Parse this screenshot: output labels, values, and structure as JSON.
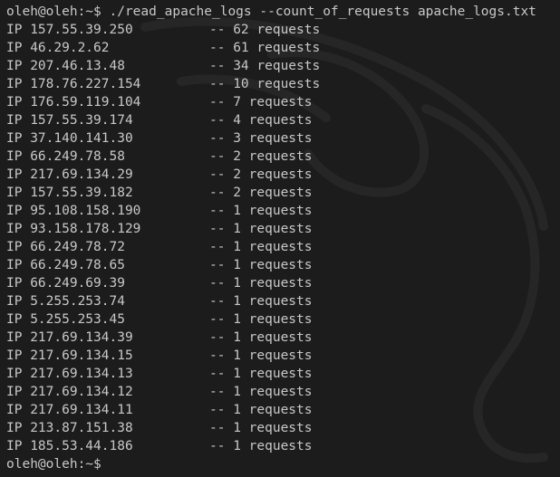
{
  "terminal": {
    "prompt": "oleh@oleh:~$",
    "command": " ./read_apache_logs --count_of_requests apache_logs.txt",
    "final_prompt": "oleh@oleh:~$"
  },
  "rows": [
    {
      "ip": "IP 157.55.39.250",
      "count": "-- 62 requests"
    },
    {
      "ip": "IP 46.29.2.62",
      "count": "-- 61 requests"
    },
    {
      "ip": "IP 207.46.13.48",
      "count": "-- 34 requests"
    },
    {
      "ip": "IP 178.76.227.154",
      "count": "-- 10 requests"
    },
    {
      "ip": "IP 176.59.119.104",
      "count": "-- 7 requests"
    },
    {
      "ip": "IP 157.55.39.174",
      "count": "-- 4 requests"
    },
    {
      "ip": "IP 37.140.141.30",
      "count": "-- 3 requests"
    },
    {
      "ip": "IP 66.249.78.58",
      "count": "-- 2 requests"
    },
    {
      "ip": "IP 217.69.134.29",
      "count": "-- 2 requests"
    },
    {
      "ip": "IP 157.55.39.182",
      "count": "-- 2 requests"
    },
    {
      "ip": "IP 95.108.158.190",
      "count": "-- 1 requests"
    },
    {
      "ip": "IP 93.158.178.129",
      "count": "-- 1 requests"
    },
    {
      "ip": "IP 66.249.78.72",
      "count": "-- 1 requests"
    },
    {
      "ip": "IP 66.249.78.65",
      "count": "-- 1 requests"
    },
    {
      "ip": "IP 66.249.69.39",
      "count": "-- 1 requests"
    },
    {
      "ip": "IP 5.255.253.74",
      "count": "-- 1 requests"
    },
    {
      "ip": "IP 5.255.253.45",
      "count": "-- 1 requests"
    },
    {
      "ip": "IP 217.69.134.39",
      "count": "-- 1 requests"
    },
    {
      "ip": "IP 217.69.134.15",
      "count": "-- 1 requests"
    },
    {
      "ip": "IP 217.69.134.13",
      "count": "-- 1 requests"
    },
    {
      "ip": "IP 217.69.134.12",
      "count": "-- 1 requests"
    },
    {
      "ip": "IP 217.69.134.11",
      "count": "-- 1 requests"
    },
    {
      "ip": "IP 213.87.151.38",
      "count": "-- 1 requests"
    },
    {
      "ip": "IP 185.53.44.186",
      "count": "-- 1 requests"
    }
  ],
  "colors": {
    "background": "#1c1c1c",
    "text": "#c8c8c8",
    "watermark": "#262626"
  },
  "watermark_icon": "kali-dragon-icon"
}
